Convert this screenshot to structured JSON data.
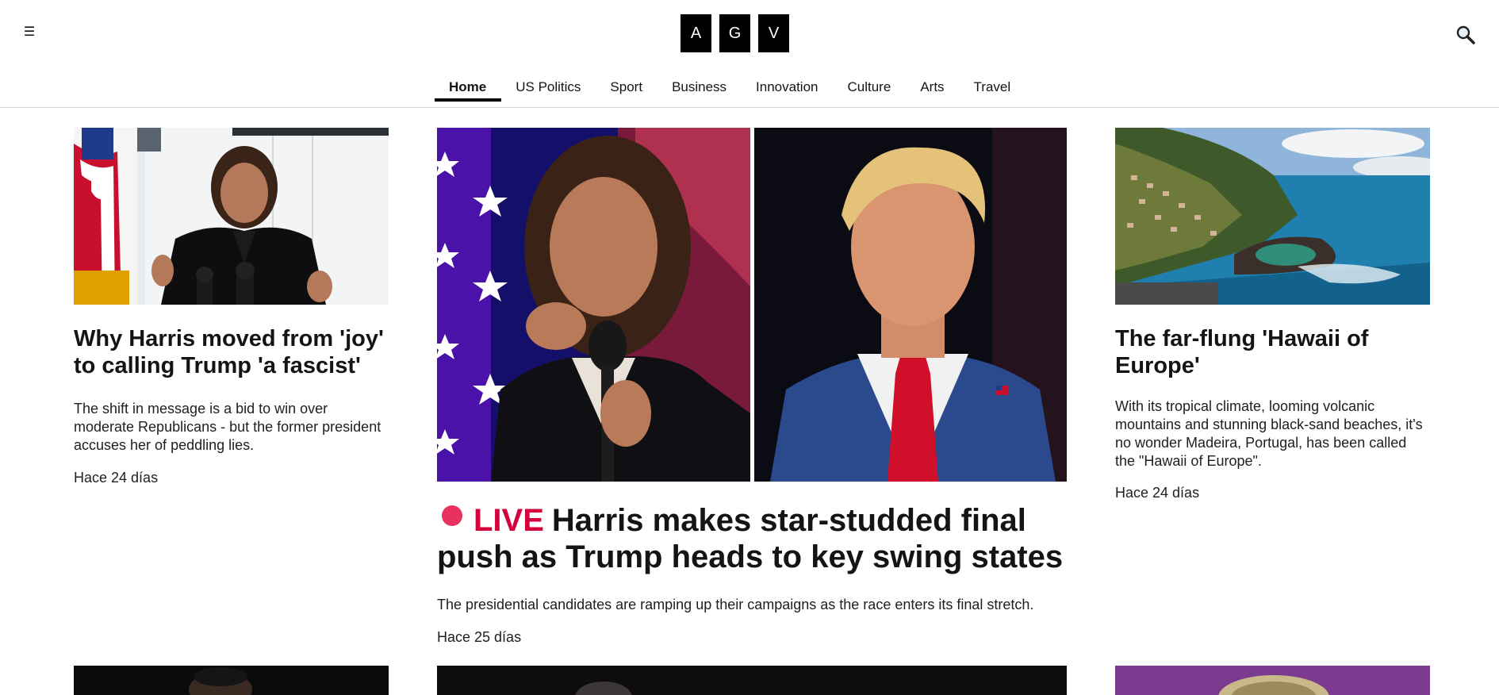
{
  "header": {
    "logo_letters": [
      "A",
      "G",
      "V"
    ],
    "nav": [
      {
        "label": "Home",
        "active": true
      },
      {
        "label": "US Politics",
        "active": false
      },
      {
        "label": "Sport",
        "active": false
      },
      {
        "label": "Business",
        "active": false
      },
      {
        "label": "Innovation",
        "active": false
      },
      {
        "label": "Culture",
        "active": false
      },
      {
        "label": "Arts",
        "active": false
      },
      {
        "label": "Travel",
        "active": false
      }
    ],
    "menu_icon": "hamburger-icon",
    "search_icon": "search-icon"
  },
  "left_story": {
    "title": "Why Harris moved from 'joy' to calling Trump 'a fascist'",
    "summary": "The shift in message is a bid to win over moderate Republicans - but the former president accuses her of peddling lies.",
    "time": "Hace 24 días"
  },
  "center_story": {
    "live_label": "LIVE",
    "title": "Harris makes star-studded final push as Trump heads to key swing states",
    "summary": "The presidential candidates are ramping up their campaigns as the race enters its final stretch.",
    "time": "Hace 25 días"
  },
  "right_story": {
    "title": "The far-flung 'Hawaii of Europe'",
    "summary": "With its tropical climate, looming volcanic mountains and stunning black-sand beaches, it's no wonder Madeira, Portugal, has been called the \"Hawaii of Europe\".",
    "time": "Hace 24 días"
  },
  "colors": {
    "live_red": "#d6003c",
    "live_dot": "#e8325e",
    "logo_bg": "#000000"
  }
}
